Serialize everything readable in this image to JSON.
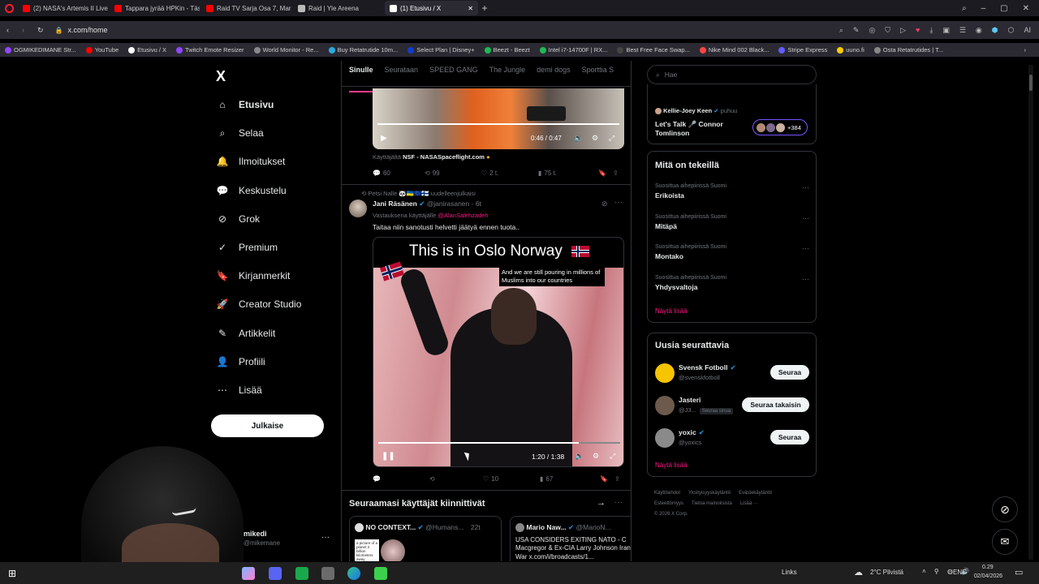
{
  "browser": {
    "tabs": [
      {
        "label": "(2) NASA's Artemis II Live",
        "color": "#ff0000"
      },
      {
        "label": "Tappara jyrää HPKin - Täs",
        "color": "#ff0000"
      },
      {
        "label": "Raid TV Sarja Osa 7, Marat",
        "color": "#ff0000"
      },
      {
        "label": "Raid | Yle Areena",
        "color": "#bbbbbb"
      },
      {
        "label": "(1) Etusivu / X",
        "color": "#ffffff"
      }
    ],
    "url": "x.com/home",
    "bookmarks": [
      {
        "label": "OGMIKEDIMANE Str...",
        "color": "#9146ff"
      },
      {
        "label": "YouTube",
        "color": "#ff0000"
      },
      {
        "label": "Etusivu / X",
        "color": "#ffffff"
      },
      {
        "label": "Twitch Emote Resizer",
        "color": "#9146ff"
      },
      {
        "label": "World Monitor - Re...",
        "color": "#888888"
      },
      {
        "label": "Buy Retatrutide 10m...",
        "color": "#2aa9e0"
      },
      {
        "label": "Select Plan | Disney+",
        "color": "#113ccf"
      },
      {
        "label": "Beezt - Beezt",
        "color": "#1db954"
      },
      {
        "label": "Intel i7-14700F | RX...",
        "color": "#1db954"
      },
      {
        "label": "Best Free Face Swap...",
        "color": "#444444"
      },
      {
        "label": "Nike Mind 002 Black...",
        "color": "#ff4444"
      },
      {
        "label": "Stripe Express",
        "color": "#635bff"
      },
      {
        "label": "uuno.fi",
        "color": "#ffcc00"
      },
      {
        "label": "Osta Retatrutides | T...",
        "color": "#888888"
      }
    ]
  },
  "nav": {
    "logo": "X",
    "items": [
      {
        "label": "Etusivu",
        "icon": "home-icon",
        "bold": true
      },
      {
        "label": "Selaa",
        "icon": "search-icon"
      },
      {
        "label": "Ilmoitukset",
        "icon": "bell-icon"
      },
      {
        "label": "Keskustelu",
        "icon": "chat-icon"
      },
      {
        "label": "Grok",
        "icon": "grok-icon"
      },
      {
        "label": "Premium",
        "icon": "premium-icon"
      },
      {
        "label": "Kirjanmerkit",
        "icon": "bookmark-icon"
      },
      {
        "label": "Creator Studio",
        "icon": "rocket-icon"
      },
      {
        "label": "Artikkelit",
        "icon": "article-icon"
      },
      {
        "label": "Profiili",
        "icon": "profile-icon"
      },
      {
        "label": "Lisää",
        "icon": "more-icon"
      }
    ],
    "post_button": "Julkaise",
    "account_name": "mikedi",
    "account_handle": "@mikemane"
  },
  "feed": {
    "tabs": [
      "Sinulle",
      "Seurataan",
      "SPEED GANG",
      "The Jungle",
      "demi dogs",
      "Sporttia S"
    ],
    "post1": {
      "time": "0:46 / 0:47",
      "caption_prefix": "Käyttäjältä",
      "caption_name": "NSF - NASASpaceflight.com",
      "replies": "60",
      "reposts": "99",
      "likes": "2 t.",
      "views": "75 t."
    },
    "post2": {
      "repost_by": "Petsi Nalle",
      "repost_suffix": "uudelleenjulkaisi",
      "name": "Jani Räsänen",
      "handle": "@janirasanen · 6t",
      "reply_to_prefix": "Vastauksena käyttäjälle",
      "reply_to": "@AlanSalehzadeh",
      "text": "Taitaa niin sanotusti helvetti jäätyä ennen tuota..",
      "video_title": "This is in Oslo Norway",
      "video_caption": "And we are still pouring in millions of Muslims into our countries",
      "time": "1:20 / 1:38",
      "likes": "10",
      "views": "67",
      "progress": 0.83
    },
    "section_title": "Seuraamasi käyttäjät kiinnittivät",
    "card1": {
      "name": "NO CONTEXT...",
      "handle": "@Humans...",
      "time": "22t",
      "thumb_text": "a picture of a planet 3 billion kilometers away"
    },
    "card2": {
      "name": "Mario Naw...",
      "handle": "@MarioN...",
      "text": "USA CONSIDERS EXITING NATO - C Macgregor & Ex-CIA Larry Johnson Iran War x.com/i/broadcasts/1..."
    }
  },
  "right": {
    "search_placeholder": "Hae",
    "space": {
      "host": "Kellie-Joey Keen",
      "host_suffix": "puhuu",
      "title": "Let's Talk 🎤 Connor Tomlinson",
      "count": "+384"
    },
    "trends_title": "Mitä on tekeillä",
    "trends": [
      {
        "context": "Suosittua aihepiirissä Suomi",
        "name": "Erikoista"
      },
      {
        "context": "Suosittua aihepiirissä Suomi",
        "name": "Mitäpä"
      },
      {
        "context": "Suosittua aihepiirissä Suomi",
        "name": "Montako"
      },
      {
        "context": "Suosittua aihepiirissä Suomi",
        "name": "Yhdysvaltoja"
      }
    ],
    "trends_more": "Näytä lisää",
    "follow_title": "Uusia seurattavia",
    "suggestions": [
      {
        "name": "Svensk Fotboll",
        "handle": "@svenskfotboll",
        "button": "Seuraa",
        "follows_you": ""
      },
      {
        "name": "Jasteri",
        "handle": "@J3...",
        "button": "Seuraa takaisin",
        "follows_you": "Seuraa sinua"
      },
      {
        "name": "yoxic",
        "handle": "@yoxics",
        "button": "Seuraa",
        "follows_you": ""
      }
    ],
    "follow_more": "Näytä lisää",
    "footer": [
      "Käyttöehdot",
      "Yksityisyyskäytäntö",
      "Evästekäytäntö",
      "Esteettömyys",
      "Tietoa mainoksista",
      "Lisää ···",
      "© 2026 X Corp."
    ]
  },
  "taskbar": {
    "links": "Links",
    "weather": "2°C  Pilvistä",
    "lang": "ENG",
    "time": "0.29",
    "date": "02/04/2026"
  }
}
